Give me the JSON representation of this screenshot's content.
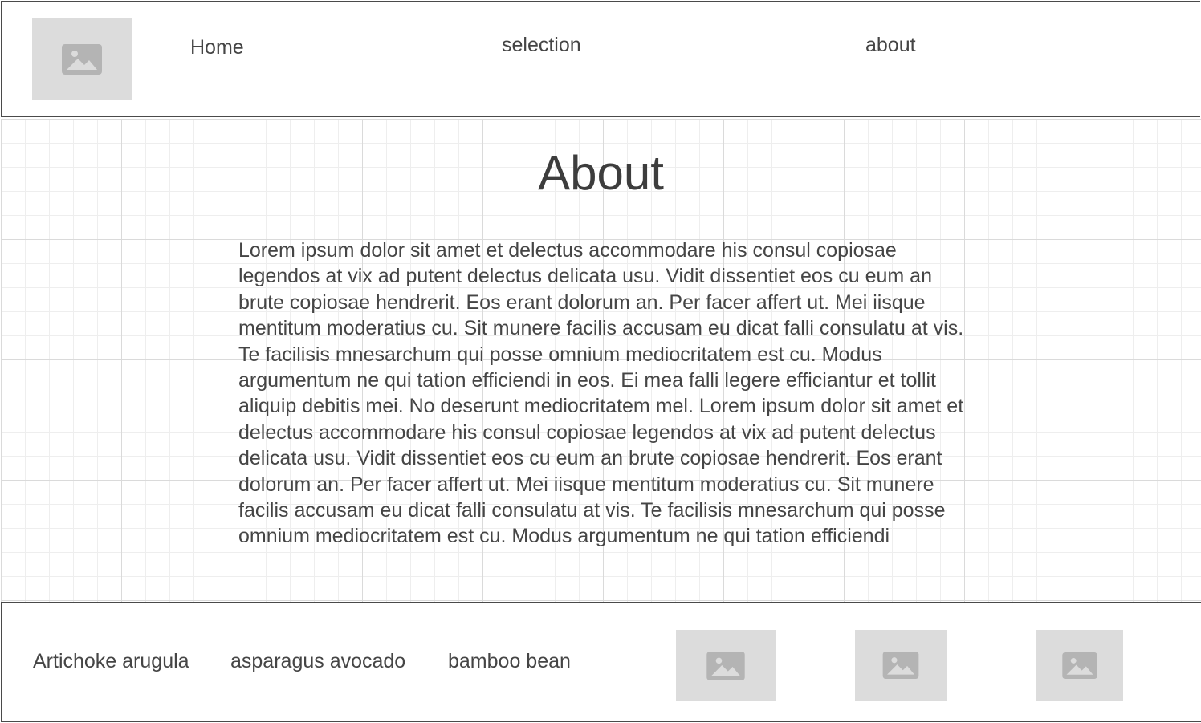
{
  "header": {
    "logo_icon": "image-placeholder-icon",
    "nav": {
      "home": "Home",
      "selection": "selection",
      "about": "about"
    }
  },
  "main": {
    "title": "About",
    "body": "Lorem ipsum dolor sit amet et delectus accommodare his consul copiosae legendos at vix ad putent delectus delicata usu. Vidit dissentiet eos cu eum an brute copiosae hendrerit. Eos erant dolorum an. Per facer affert ut. Mei iisque mentitum moderatius cu. Sit munere facilis accusam eu dicat falli consulatu at vis. Te facilisis mnesarchum qui posse omnium mediocritatem est cu. Modus argumentum ne qui tation efficiendi in eos. Ei mea falli legere efficiantur et tollit aliquip debitis mei. No deserunt mediocritatem mel. Lorem ipsum dolor sit amet et delectus accommodare his consul copiosae legendos at vix ad putent delectus delicata usu. Vidit dissentiet eos cu eum an brute copiosae hendrerit. Eos erant dolorum an. Per facer affert ut. Mei iisque mentitum moderatius cu. Sit munere facilis accusam eu dicat falli consulatu at vis. Te facilisis mnesarchum qui posse omnium mediocritatem est cu. Modus argumentum ne qui tation efficiendi"
  },
  "footer": {
    "links": [
      "Artichoke arugula",
      "asparagus avocado",
      "bamboo bean"
    ],
    "image_icons": [
      "image-placeholder-icon",
      "image-placeholder-icon",
      "image-placeholder-icon"
    ]
  },
  "colors": {
    "text": "#454545",
    "placeholder_bg": "#dcdcdc",
    "placeholder_icon": "#b4b4b4",
    "border": "#4a4a4a",
    "grid_major": "#dadada",
    "grid_minor": "#eeeeee"
  }
}
